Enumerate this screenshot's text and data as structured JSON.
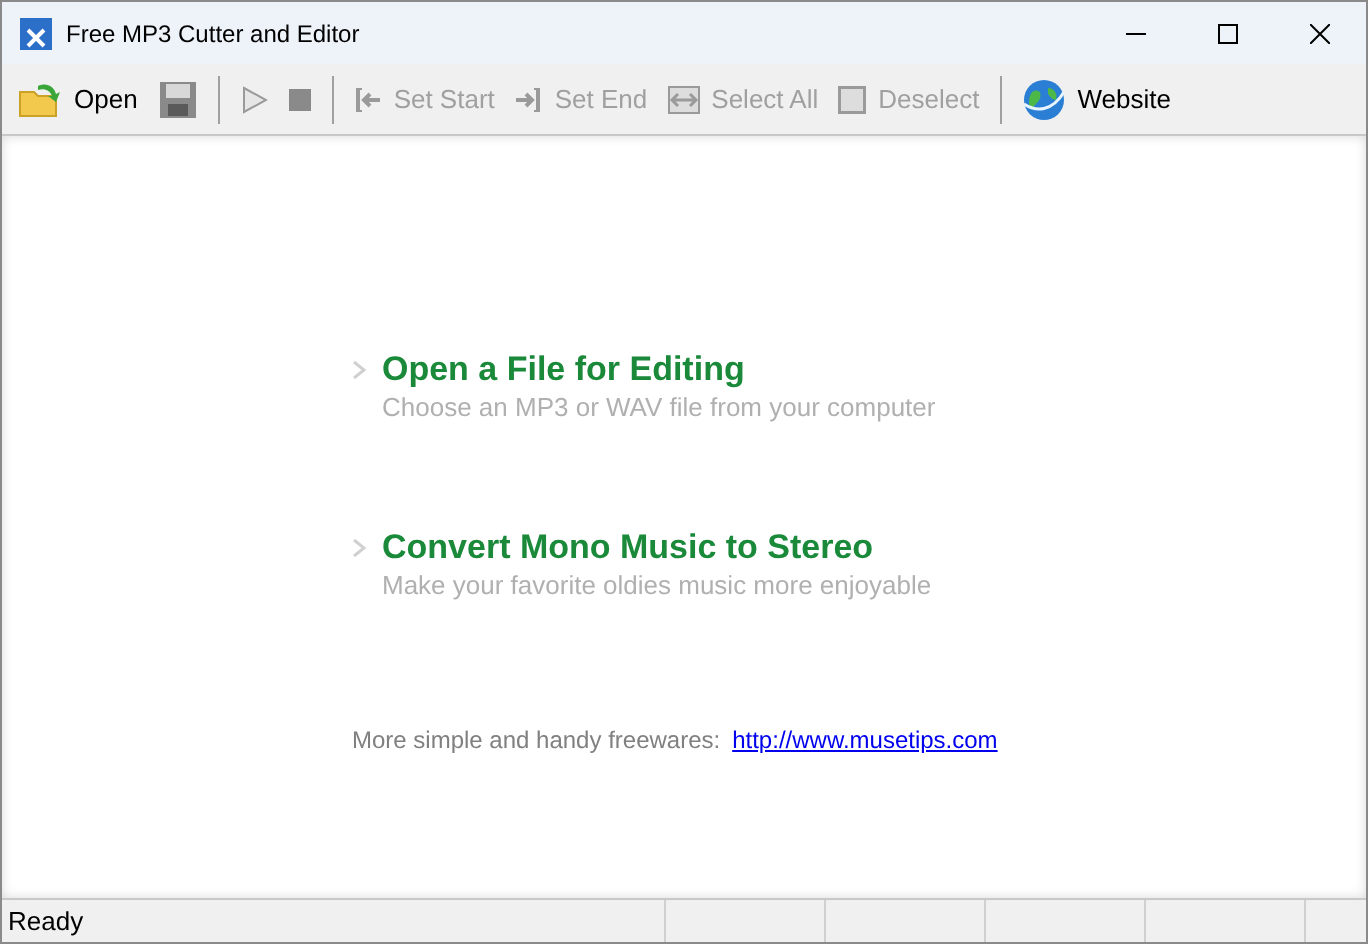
{
  "window": {
    "title": "Free MP3 Cutter and Editor"
  },
  "toolbar": [
    {
      "kind": "open",
      "label": "Open",
      "disabled": false
    },
    {
      "kind": "save",
      "disabled": true
    },
    {
      "kind": "separator"
    },
    {
      "kind": "play",
      "disabled": true
    },
    {
      "kind": "stop",
      "disabled": true
    },
    {
      "kind": "separator"
    },
    {
      "kind": "set-start",
      "label": "Set Start",
      "disabled": true
    },
    {
      "kind": "set-end",
      "label": "Set End",
      "disabled": true
    },
    {
      "kind": "select-all",
      "label": "Select All",
      "disabled": true
    },
    {
      "kind": "deselect",
      "label": "Deselect",
      "disabled": true
    },
    {
      "kind": "separator"
    },
    {
      "kind": "website",
      "label": "Website",
      "disabled": false
    }
  ],
  "tasks": [
    {
      "title": "Open a File for Editing",
      "description": "Choose an MP3 or WAV file from your computer"
    },
    {
      "title": "Convert Mono Music to Stereo",
      "description": "Make your favorite oldies music more enjoyable"
    }
  ],
  "footer": {
    "text": "More simple and handy freewares:",
    "link": "http://www.musetips.com"
  },
  "status_bar": {
    "text": "Ready"
  }
}
